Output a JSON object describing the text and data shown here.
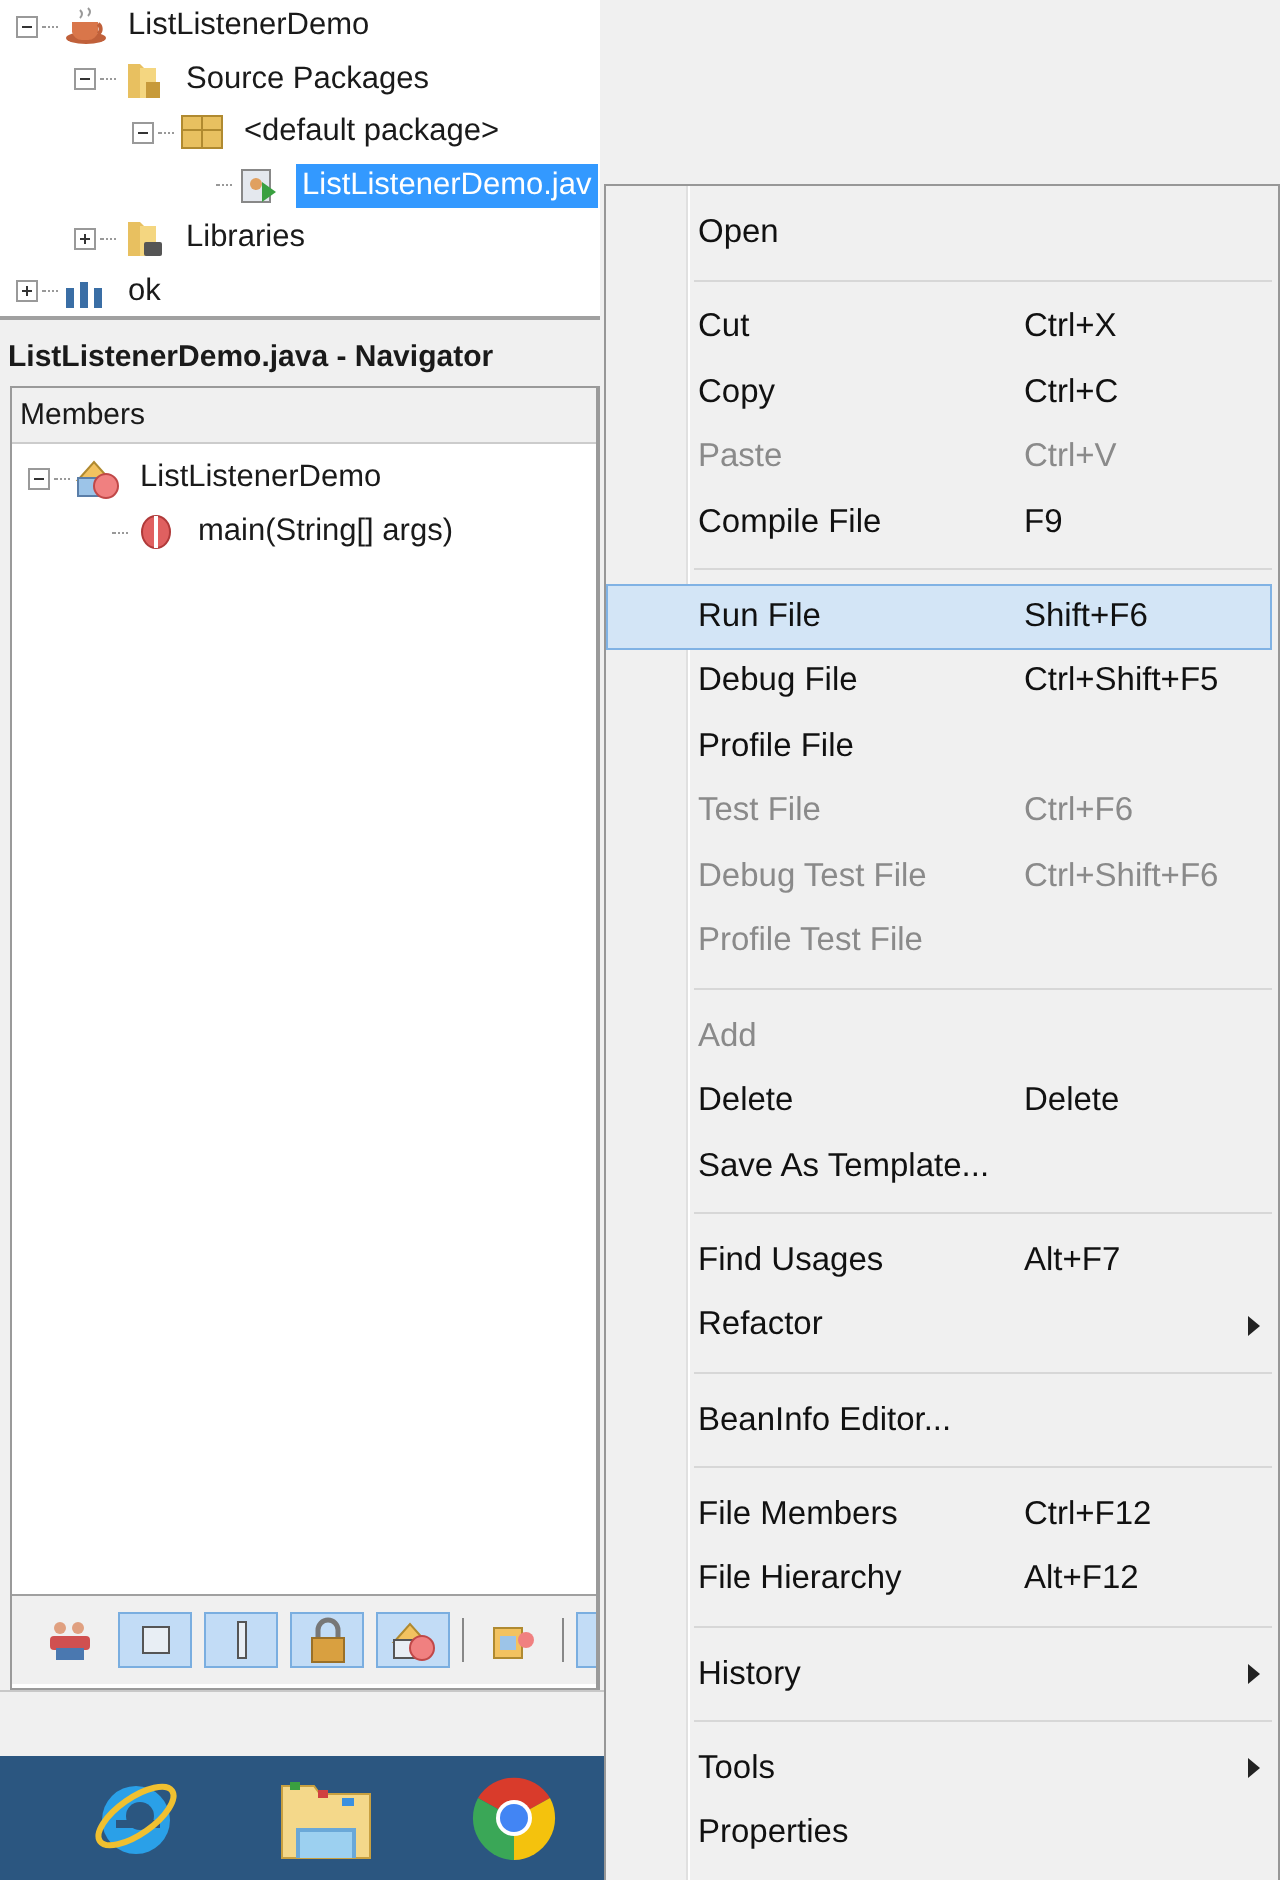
{
  "project_tree": [
    {
      "label": "ListListenerDemo",
      "kind": "project",
      "expanded": true,
      "selected": false,
      "children": [
        {
          "label": "Source Packages",
          "kind": "source-folder",
          "expanded": true,
          "selected": false,
          "children": [
            {
              "label": "<default package>",
              "kind": "package",
              "expanded": true,
              "selected": false,
              "children": [
                {
                  "label": "ListListenerDemo.jav",
                  "kind": "java-file",
                  "selected": true
                }
              ]
            }
          ]
        },
        {
          "label": "Libraries",
          "kind": "library",
          "expanded": false,
          "selected": false
        }
      ]
    },
    {
      "label": "ok",
      "kind": "project-alt",
      "expanded": false,
      "selected": false
    }
  ],
  "navigator": {
    "title": "ListListenerDemo.java - Navigator",
    "column": "Members",
    "members": [
      {
        "label": "ListListenerDemo",
        "kind": "class",
        "expanded": true,
        "children": [
          {
            "label": "main(String[] args)",
            "kind": "method"
          }
        ]
      }
    ],
    "toolbar": [
      {
        "pressed": false
      },
      {
        "pressed": true
      },
      {
        "pressed": true
      },
      {
        "pressed": true
      },
      {
        "pressed": true
      },
      {
        "pressed": false
      },
      {
        "pressed": true
      }
    ]
  },
  "context_menu": [
    {
      "kind": "item",
      "label": "Open",
      "disabled": false,
      "selected": false
    },
    {
      "kind": "separator"
    },
    {
      "kind": "item",
      "label": "Cut",
      "shortcut": "Ctrl+X",
      "disabled": false,
      "selected": false
    },
    {
      "kind": "item",
      "label": "Copy",
      "shortcut": "Ctrl+C",
      "disabled": false,
      "selected": false
    },
    {
      "kind": "item",
      "label": "Paste",
      "shortcut": "Ctrl+V",
      "disabled": true,
      "selected": false
    },
    {
      "kind": "item",
      "label": "Compile File",
      "shortcut": "F9",
      "disabled": false,
      "selected": false
    },
    {
      "kind": "separator"
    },
    {
      "kind": "item",
      "label": "Run File",
      "shortcut": "Shift+F6",
      "disabled": false,
      "selected": true
    },
    {
      "kind": "item",
      "label": "Debug File",
      "shortcut": "Ctrl+Shift+F5",
      "disabled": false,
      "selected": false
    },
    {
      "kind": "item",
      "label": "Profile File",
      "disabled": false,
      "selected": false
    },
    {
      "kind": "item",
      "label": "Test File",
      "shortcut": "Ctrl+F6",
      "disabled": true,
      "selected": false
    },
    {
      "kind": "item",
      "label": "Debug Test File",
      "shortcut": "Ctrl+Shift+F6",
      "disabled": true,
      "selected": false
    },
    {
      "kind": "item",
      "label": "Profile Test File",
      "disabled": true,
      "selected": false
    },
    {
      "kind": "separator"
    },
    {
      "kind": "item",
      "label": "Add",
      "disabled": true,
      "selected": false
    },
    {
      "kind": "item",
      "label": "Delete",
      "shortcut": "Delete",
      "disabled": false,
      "selected": false
    },
    {
      "kind": "item",
      "label": "Save As Template...",
      "disabled": false,
      "selected": false
    },
    {
      "kind": "separator"
    },
    {
      "kind": "item",
      "label": "Find Usages",
      "shortcut": "Alt+F7",
      "disabled": false,
      "selected": false
    },
    {
      "kind": "item",
      "label": "Refactor",
      "submenu": true,
      "disabled": false,
      "selected": false
    },
    {
      "kind": "separator"
    },
    {
      "kind": "item",
      "label": "BeanInfo Editor...",
      "disabled": false,
      "selected": false
    },
    {
      "kind": "separator"
    },
    {
      "kind": "item",
      "label": "File Members",
      "shortcut": "Ctrl+F12",
      "disabled": false,
      "selected": false
    },
    {
      "kind": "item",
      "label": "File Hierarchy",
      "shortcut": "Alt+F12",
      "disabled": false,
      "selected": false
    },
    {
      "kind": "separator"
    },
    {
      "kind": "item",
      "label": "History",
      "submenu": true,
      "disabled": false,
      "selected": false
    },
    {
      "kind": "separator"
    },
    {
      "kind": "item",
      "label": "Tools",
      "submenu": true,
      "disabled": false,
      "selected": false
    },
    {
      "kind": "item",
      "label": "Properties",
      "disabled": false,
      "selected": false
    }
  ]
}
